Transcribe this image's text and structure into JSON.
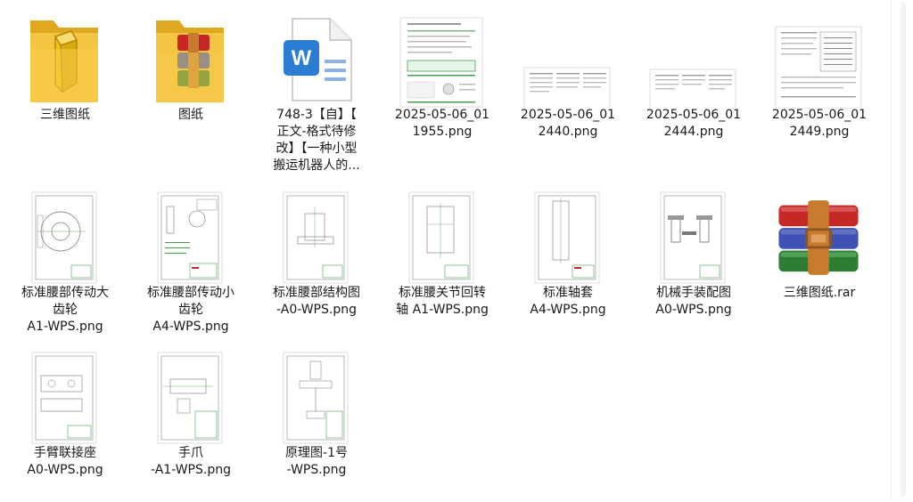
{
  "files": [
    {
      "name": "三维图纸",
      "type": "folder",
      "icon": "folder-3d-icon"
    },
    {
      "name": "图纸",
      "type": "folder",
      "icon": "folder-archive-icon"
    },
    {
      "name": "748-3【自】【正文-格式待修改】【一种小型搬运机器人的...",
      "type": "docx",
      "icon": "word-document-icon"
    },
    {
      "name": "2025-05-06_011955.png",
      "type": "png",
      "icon": "image-thumbnail-icon"
    },
    {
      "name": "2025-05-06_012440.png",
      "type": "png",
      "icon": "image-thumbnail-icon"
    },
    {
      "name": "2025-05-06_012444.png",
      "type": "png",
      "icon": "image-thumbnail-icon"
    },
    {
      "name": "2025-05-06_012449.png",
      "type": "png",
      "icon": "image-thumbnail-icon"
    },
    {
      "name": "标准腰部传动大齿轮A1-WPS.png",
      "type": "png",
      "icon": "drawing-thumbnail-icon"
    },
    {
      "name": "标准腰部传动小齿轮A4-WPS.png",
      "type": "png",
      "icon": "drawing-thumbnail-icon"
    },
    {
      "name": "标准腰部结构图-A0-WPS.png",
      "type": "png",
      "icon": "drawing-thumbnail-icon"
    },
    {
      "name": "标准腰关节回转轴 A1-WPS.png",
      "type": "png",
      "icon": "drawing-thumbnail-icon"
    },
    {
      "name": "标准轴套A4-WPS.png",
      "type": "png",
      "icon": "drawing-thumbnail-icon"
    },
    {
      "name": "机械手装配图A0-WPS.png",
      "type": "png",
      "icon": "drawing-thumbnail-icon"
    },
    {
      "name": "三维图纸.rar",
      "type": "rar",
      "icon": "winrar-archive-icon"
    },
    {
      "name": "手臂联接座A0-WPS.png",
      "type": "png",
      "icon": "drawing-thumbnail-icon"
    },
    {
      "name": "手爪-A1-WPS.png",
      "type": "png",
      "icon": "drawing-thumbnail-icon"
    },
    {
      "name": "原理图-1号-WPS.png",
      "type": "png",
      "icon": "drawing-thumbnail-icon"
    }
  ],
  "labels": [
    [
      "三维图纸"
    ],
    [
      "图纸"
    ],
    [
      "748-3【自】【",
      "正文-格式待修",
      "改】【一种小型",
      "搬运机器人的..."
    ],
    [
      "2025-05-06_01",
      "1955.png"
    ],
    [
      "2025-05-06_01",
      "2440.png"
    ],
    [
      "2025-05-06_01",
      "2444.png"
    ],
    [
      "2025-05-06_01",
      "2449.png"
    ],
    [
      "标准腰部传动大",
      "齿轮",
      "A1-WPS.png"
    ],
    [
      "标准腰部传动小",
      "齿轮",
      "A4-WPS.png"
    ],
    [
      "标准腰部结构图",
      "-A0-WPS.png"
    ],
    [
      "标准腰关节回转",
      "轴 A1-WPS.png"
    ],
    [
      "标准轴套",
      "A4-WPS.png"
    ],
    [
      "机械手装配图",
      "A0-WPS.png"
    ],
    [
      "三维图纸.rar"
    ],
    [
      "手臂联接座",
      "A0-WPS.png"
    ],
    [
      "手爪",
      "-A1-WPS.png"
    ],
    [
      "原理图-1号",
      "-WPS.png"
    ]
  ],
  "colors": {
    "folder": "#f4c542",
    "folder_dark": "#e0a820",
    "word_blue": "#2b7cd3",
    "rar_red": "#c62828",
    "rar_blue": "#3f51b5",
    "rar_green": "#2e7d32",
    "rar_strap": "#c77b2e"
  }
}
